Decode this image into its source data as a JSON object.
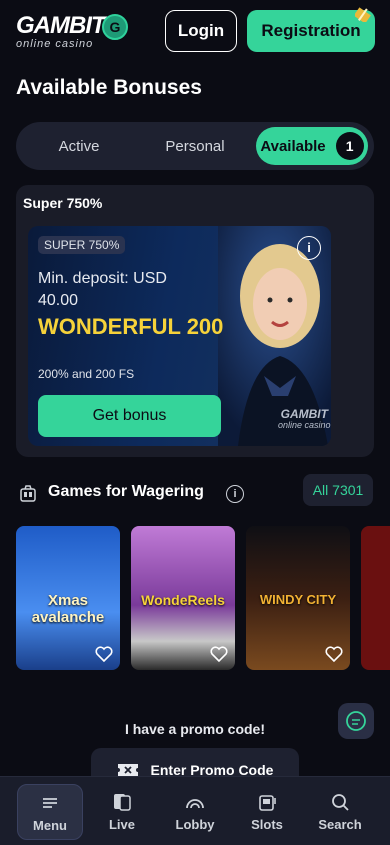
{
  "header": {
    "logo_text": "GAMBIT",
    "logo_letter": "G",
    "logo_sub": "online casino",
    "login_label": "Login",
    "register_label": "Registration"
  },
  "page_title": "Available Bonuses",
  "tabs": [
    {
      "label": "Active"
    },
    {
      "label": "Personal"
    },
    {
      "label": "Available",
      "count": "1",
      "selected": true
    }
  ],
  "bonus_section": {
    "heading": "Super 750%",
    "card": {
      "tag": "SUPER 750%",
      "min_deposit": "Min. deposit: USD 40.00",
      "title": "WONDERFUL 200",
      "subtitle": "200% and 200 FS",
      "button_label": "Get bonus",
      "logo_text": "GAMBIT",
      "logo_sub": "online casino"
    }
  },
  "games_section": {
    "heading": "Games for Wagering",
    "all_label": "All 7301",
    "games": [
      {
        "title": "Xmas avalanche",
        "color": "#2a6fcf"
      },
      {
        "title": "WondeReels",
        "color": "#9a3fb0"
      },
      {
        "title": "WINDY CITY",
        "color": "#3b1f12"
      }
    ]
  },
  "promo": {
    "question": "I have a promo code!",
    "button_label": "Enter Promo Code"
  },
  "bottom_nav": [
    {
      "label": "Menu",
      "icon": "menu-icon",
      "active": true
    },
    {
      "label": "Live",
      "icon": "cards-icon"
    },
    {
      "label": "Lobby",
      "icon": "lobby-icon"
    },
    {
      "label": "Slots",
      "icon": "slot-machine-icon"
    },
    {
      "label": "Search",
      "icon": "search-icon"
    }
  ],
  "colors": {
    "accent": "#35d49a",
    "background": "#0b0c14",
    "gold": "#f6d23a"
  }
}
